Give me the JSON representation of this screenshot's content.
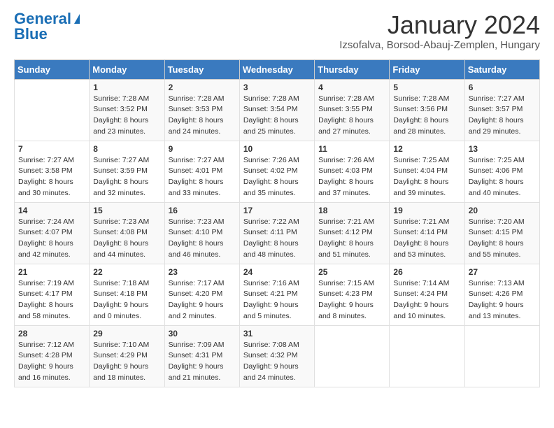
{
  "header": {
    "logo_general": "General",
    "logo_blue": "Blue",
    "month_year": "January 2024",
    "location": "Izsofalva, Borsod-Abauj-Zemplen, Hungary"
  },
  "days_of_week": [
    "Sunday",
    "Monday",
    "Tuesday",
    "Wednesday",
    "Thursday",
    "Friday",
    "Saturday"
  ],
  "weeks": [
    [
      {
        "day": "",
        "sunrise": "",
        "sunset": "",
        "daylight": ""
      },
      {
        "day": "1",
        "sunrise": "Sunrise: 7:28 AM",
        "sunset": "Sunset: 3:52 PM",
        "daylight": "Daylight: 8 hours and 23 minutes."
      },
      {
        "day": "2",
        "sunrise": "Sunrise: 7:28 AM",
        "sunset": "Sunset: 3:53 PM",
        "daylight": "Daylight: 8 hours and 24 minutes."
      },
      {
        "day": "3",
        "sunrise": "Sunrise: 7:28 AM",
        "sunset": "Sunset: 3:54 PM",
        "daylight": "Daylight: 8 hours and 25 minutes."
      },
      {
        "day": "4",
        "sunrise": "Sunrise: 7:28 AM",
        "sunset": "Sunset: 3:55 PM",
        "daylight": "Daylight: 8 hours and 27 minutes."
      },
      {
        "day": "5",
        "sunrise": "Sunrise: 7:28 AM",
        "sunset": "Sunset: 3:56 PM",
        "daylight": "Daylight: 8 hours and 28 minutes."
      },
      {
        "day": "6",
        "sunrise": "Sunrise: 7:27 AM",
        "sunset": "Sunset: 3:57 PM",
        "daylight": "Daylight: 8 hours and 29 minutes."
      }
    ],
    [
      {
        "day": "7",
        "sunrise": "Sunrise: 7:27 AM",
        "sunset": "Sunset: 3:58 PM",
        "daylight": "Daylight: 8 hours and 30 minutes."
      },
      {
        "day": "8",
        "sunrise": "Sunrise: 7:27 AM",
        "sunset": "Sunset: 3:59 PM",
        "daylight": "Daylight: 8 hours and 32 minutes."
      },
      {
        "day": "9",
        "sunrise": "Sunrise: 7:27 AM",
        "sunset": "Sunset: 4:01 PM",
        "daylight": "Daylight: 8 hours and 33 minutes."
      },
      {
        "day": "10",
        "sunrise": "Sunrise: 7:26 AM",
        "sunset": "Sunset: 4:02 PM",
        "daylight": "Daylight: 8 hours and 35 minutes."
      },
      {
        "day": "11",
        "sunrise": "Sunrise: 7:26 AM",
        "sunset": "Sunset: 4:03 PM",
        "daylight": "Daylight: 8 hours and 37 minutes."
      },
      {
        "day": "12",
        "sunrise": "Sunrise: 7:25 AM",
        "sunset": "Sunset: 4:04 PM",
        "daylight": "Daylight: 8 hours and 39 minutes."
      },
      {
        "day": "13",
        "sunrise": "Sunrise: 7:25 AM",
        "sunset": "Sunset: 4:06 PM",
        "daylight": "Daylight: 8 hours and 40 minutes."
      }
    ],
    [
      {
        "day": "14",
        "sunrise": "Sunrise: 7:24 AM",
        "sunset": "Sunset: 4:07 PM",
        "daylight": "Daylight: 8 hours and 42 minutes."
      },
      {
        "day": "15",
        "sunrise": "Sunrise: 7:23 AM",
        "sunset": "Sunset: 4:08 PM",
        "daylight": "Daylight: 8 hours and 44 minutes."
      },
      {
        "day": "16",
        "sunrise": "Sunrise: 7:23 AM",
        "sunset": "Sunset: 4:10 PM",
        "daylight": "Daylight: 8 hours and 46 minutes."
      },
      {
        "day": "17",
        "sunrise": "Sunrise: 7:22 AM",
        "sunset": "Sunset: 4:11 PM",
        "daylight": "Daylight: 8 hours and 48 minutes."
      },
      {
        "day": "18",
        "sunrise": "Sunrise: 7:21 AM",
        "sunset": "Sunset: 4:12 PM",
        "daylight": "Daylight: 8 hours and 51 minutes."
      },
      {
        "day": "19",
        "sunrise": "Sunrise: 7:21 AM",
        "sunset": "Sunset: 4:14 PM",
        "daylight": "Daylight: 8 hours and 53 minutes."
      },
      {
        "day": "20",
        "sunrise": "Sunrise: 7:20 AM",
        "sunset": "Sunset: 4:15 PM",
        "daylight": "Daylight: 8 hours and 55 minutes."
      }
    ],
    [
      {
        "day": "21",
        "sunrise": "Sunrise: 7:19 AM",
        "sunset": "Sunset: 4:17 PM",
        "daylight": "Daylight: 8 hours and 58 minutes."
      },
      {
        "day": "22",
        "sunrise": "Sunrise: 7:18 AM",
        "sunset": "Sunset: 4:18 PM",
        "daylight": "Daylight: 9 hours and 0 minutes."
      },
      {
        "day": "23",
        "sunrise": "Sunrise: 7:17 AM",
        "sunset": "Sunset: 4:20 PM",
        "daylight": "Daylight: 9 hours and 2 minutes."
      },
      {
        "day": "24",
        "sunrise": "Sunrise: 7:16 AM",
        "sunset": "Sunset: 4:21 PM",
        "daylight": "Daylight: 9 hours and 5 minutes."
      },
      {
        "day": "25",
        "sunrise": "Sunrise: 7:15 AM",
        "sunset": "Sunset: 4:23 PM",
        "daylight": "Daylight: 9 hours and 8 minutes."
      },
      {
        "day": "26",
        "sunrise": "Sunrise: 7:14 AM",
        "sunset": "Sunset: 4:24 PM",
        "daylight": "Daylight: 9 hours and 10 minutes."
      },
      {
        "day": "27",
        "sunrise": "Sunrise: 7:13 AM",
        "sunset": "Sunset: 4:26 PM",
        "daylight": "Daylight: 9 hours and 13 minutes."
      }
    ],
    [
      {
        "day": "28",
        "sunrise": "Sunrise: 7:12 AM",
        "sunset": "Sunset: 4:28 PM",
        "daylight": "Daylight: 9 hours and 16 minutes."
      },
      {
        "day": "29",
        "sunrise": "Sunrise: 7:10 AM",
        "sunset": "Sunset: 4:29 PM",
        "daylight": "Daylight: 9 hours and 18 minutes."
      },
      {
        "day": "30",
        "sunrise": "Sunrise: 7:09 AM",
        "sunset": "Sunset: 4:31 PM",
        "daylight": "Daylight: 9 hours and 21 minutes."
      },
      {
        "day": "31",
        "sunrise": "Sunrise: 7:08 AM",
        "sunset": "Sunset: 4:32 PM",
        "daylight": "Daylight: 9 hours and 24 minutes."
      },
      {
        "day": "",
        "sunrise": "",
        "sunset": "",
        "daylight": ""
      },
      {
        "day": "",
        "sunrise": "",
        "sunset": "",
        "daylight": ""
      },
      {
        "day": "",
        "sunrise": "",
        "sunset": "",
        "daylight": ""
      }
    ]
  ]
}
